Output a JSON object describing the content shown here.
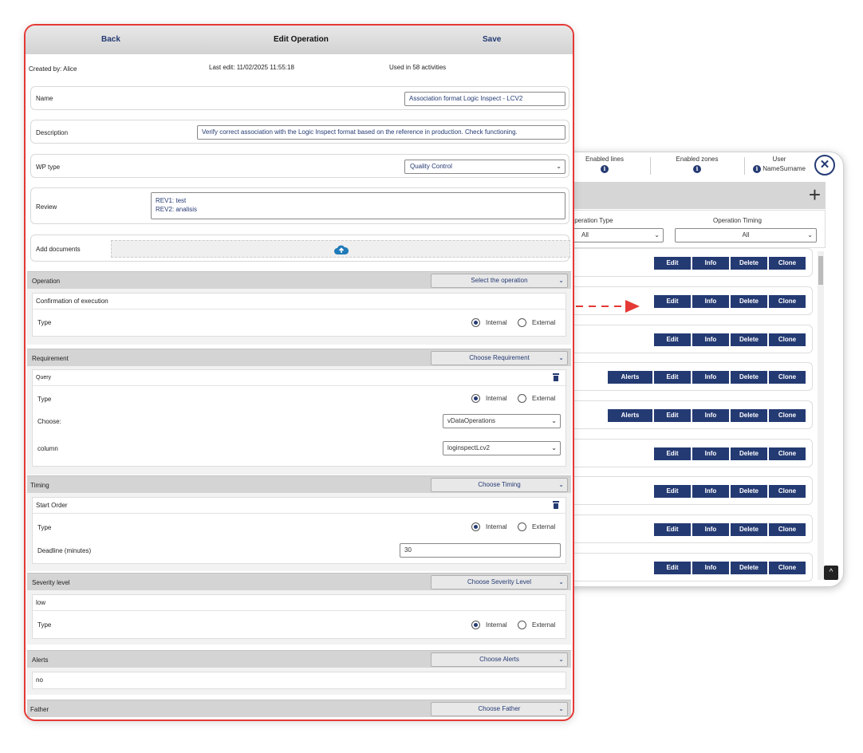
{
  "list_panel": {
    "headers": [
      {
        "label": "Enabled lines"
      },
      {
        "label": "Enabled zones"
      },
      {
        "label": "User",
        "value": "NameSurname"
      }
    ],
    "add_icon": "plus-icon",
    "close_icon": "close-icon",
    "filters": [
      {
        "label": "Operation Type",
        "value": "All"
      },
      {
        "label": "Operation Timing",
        "value": "All"
      }
    ],
    "buttons": {
      "alerts": "Alerts",
      "edit": "Edit",
      "info": "Info",
      "delete": "Delete",
      "clone": "Clone"
    },
    "rows": [
      {
        "has_alerts": false
      },
      {
        "has_alerts": false
      },
      {
        "has_alerts": false
      },
      {
        "has_alerts": true
      },
      {
        "has_alerts": true
      },
      {
        "has_alerts": false
      },
      {
        "has_alerts": false
      },
      {
        "has_alerts": false
      },
      {
        "has_alerts": false
      }
    ]
  },
  "edit": {
    "back": "Back",
    "title": "Edit Operation",
    "save": "Save",
    "created_by": "Created by: Alice",
    "last_edit": "Last edit: 11/02/2025 11:55:18",
    "used_in": "Used in 58 activities",
    "name_label": "Name",
    "name_value": "Association format Logic Inspect - LCV2",
    "description_label": "Description",
    "description_value": "Verify correct association with the Logic Inspect format based on the reference in production. Check functioning.",
    "wp_type_label": "WP type",
    "wp_type_value": "Quality Control",
    "review_label": "Review",
    "review_lines": [
      "REV1: test",
      "REV2: analisis"
    ],
    "add_documents_label": "Add documents",
    "upload_icon": "cloud-upload-icon",
    "operation": {
      "label": "Operation",
      "select": "Select the operation",
      "item": "Confirmation of execution",
      "type_label": "Type",
      "internal": "Internal",
      "external": "External",
      "selected": "Internal"
    },
    "requirement": {
      "label": "Requirement",
      "select": "Choose Requirement",
      "item": "Query",
      "type_label": "Type",
      "internal": "Internal",
      "external": "External",
      "selected": "Internal",
      "choose_label": "Choose:",
      "choose_value": "vDataOperations",
      "column_label": "column",
      "column_value": "loginspectLcv2"
    },
    "timing": {
      "label": "Timing",
      "select": "Choose Timing",
      "item": "Start Order",
      "type_label": "Type",
      "internal": "Internal",
      "external": "External",
      "selected": "Internal",
      "deadline_label": "Deadline (minutes)",
      "deadline_value": "30"
    },
    "severity": {
      "label": "Severity level",
      "select": "Choose Severity Level",
      "item": "low",
      "type_label": "Type",
      "internal": "Internal",
      "external": "External",
      "selected": "Internal"
    },
    "alerts": {
      "label": "Alerts",
      "select": "Choose Alerts",
      "item": "no"
    },
    "father": {
      "label": "Father",
      "select": "Choose Father"
    }
  },
  "colors": {
    "accent": "#243a73",
    "highlight_border": "#e53935",
    "arrow": "#e53935"
  }
}
